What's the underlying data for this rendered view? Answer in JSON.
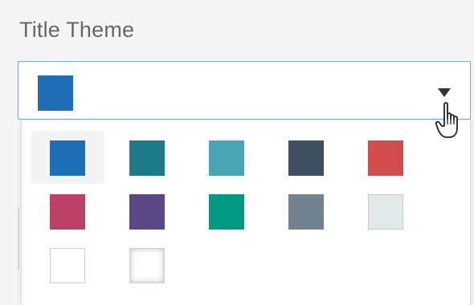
{
  "label": "Title Theme",
  "selected": {
    "color": "#1f6fb8",
    "index": 0
  },
  "palette": [
    {
      "color": "#1f6fb8",
      "style": "normal"
    },
    {
      "color": "#1d7a88",
      "style": "normal"
    },
    {
      "color": "#4aa6b7",
      "style": "normal"
    },
    {
      "color": "#3f5060",
      "style": "normal"
    },
    {
      "color": "#d24c4c",
      "style": "normal"
    },
    {
      "color": "#bd4069",
      "style": "normal"
    },
    {
      "color": "#5c4785",
      "style": "normal"
    },
    {
      "color": "#009a82",
      "style": "normal"
    },
    {
      "color": "#728390",
      "style": "normal"
    },
    {
      "color": "#e3e9e9",
      "style": "light"
    },
    {
      "color": "#ffffff",
      "style": "light"
    },
    {
      "color": "#ffffff",
      "style": "glow"
    }
  ],
  "icons": {
    "arrow": "chevron-down-icon",
    "cursor": "hand-pointer-icon"
  }
}
